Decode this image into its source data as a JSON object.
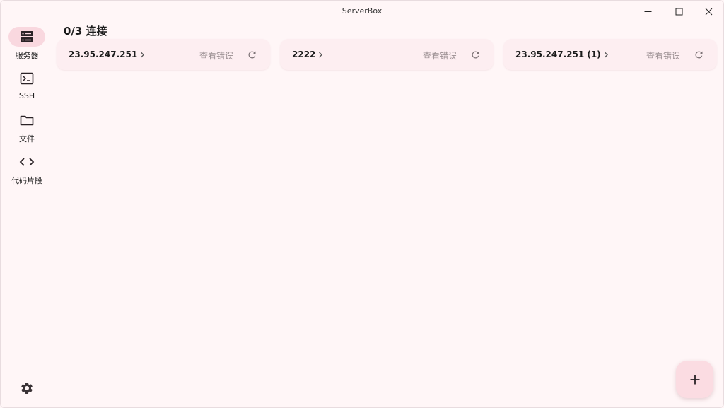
{
  "app": {
    "title": "ServerBox"
  },
  "nav": {
    "items": [
      {
        "label": "服务器",
        "icon": "server-icon",
        "active": true
      },
      {
        "label": "SSH",
        "icon": "terminal-icon",
        "active": false
      },
      {
        "label": "文件",
        "icon": "folder-icon",
        "active": false
      },
      {
        "label": "代码片段",
        "icon": "code-icon",
        "active": false
      }
    ],
    "settings_icon": "gear-icon"
  },
  "main": {
    "title": "0/3 连接",
    "servers": [
      {
        "name": "23.95.247.251",
        "error_label": "查看错误"
      },
      {
        "name": "2222",
        "error_label": "查看错误"
      },
      {
        "name": "23.95.247.251 (1)",
        "error_label": "查看错误"
      }
    ]
  },
  "fab": {
    "icon": "plus-icon"
  },
  "colors": {
    "background": "#fff6f7",
    "card": "#fdeef1",
    "accent": "#f9d8df",
    "muted_text": "#9b8f92"
  }
}
